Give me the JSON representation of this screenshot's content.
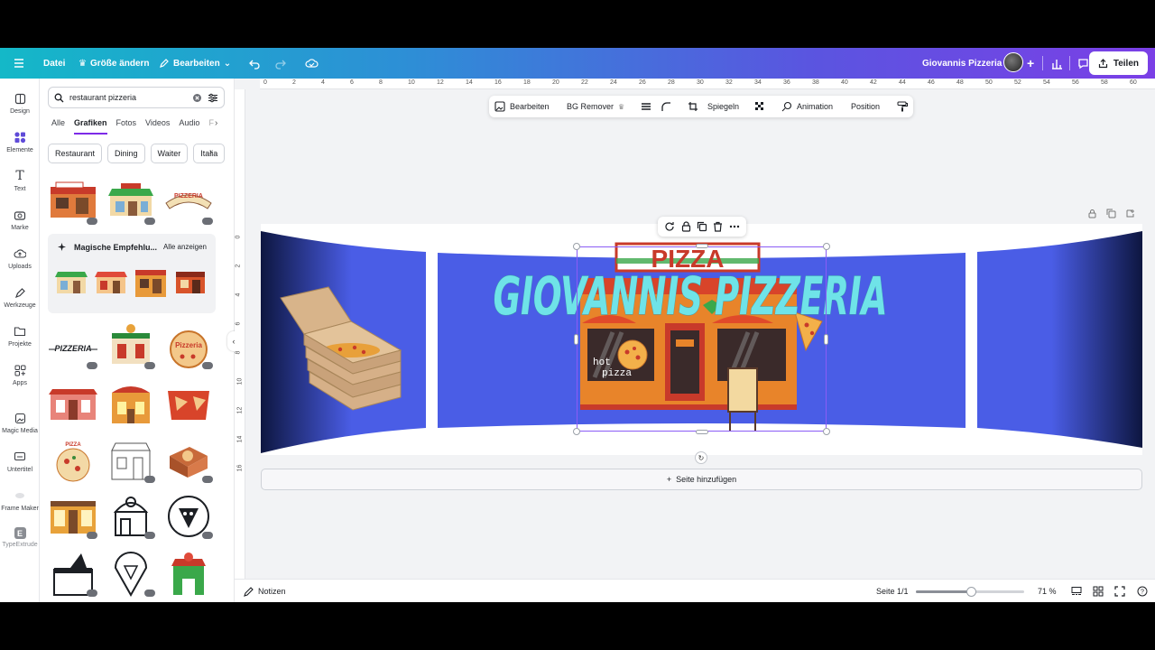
{
  "topbar": {
    "file": "Datei",
    "resize": "Größe ändern",
    "edit": "Bearbeiten",
    "project_title": "Giovannis Pizzeria",
    "share": "Teilen"
  },
  "rail": [
    {
      "label": "Design"
    },
    {
      "label": "Elemente"
    },
    {
      "label": "Text"
    },
    {
      "label": "Marke"
    },
    {
      "label": "Uploads"
    },
    {
      "label": "Werkzeuge"
    },
    {
      "label": "Projekte"
    },
    {
      "label": "Apps"
    },
    {
      "label": "Magic Media"
    },
    {
      "label": "Untertitel"
    },
    {
      "label": "Frame Maker"
    },
    {
      "label": "TypeExtrude"
    }
  ],
  "panel": {
    "search_value": "restaurant pizzeria",
    "tabs": [
      "Alle",
      "Grafiken",
      "Fotos",
      "Videos",
      "Audio",
      "F"
    ],
    "active_tab": "Grafiken",
    "chips": [
      "Restaurant",
      "Dining",
      "Waiter",
      "Italia"
    ],
    "magic_title": "Magische Empfehlu...",
    "magic_all": "Alle anzeigen"
  },
  "ruler": {
    "top": [
      "0",
      "2",
      "4",
      "6",
      "8",
      "10",
      "12",
      "14",
      "16",
      "18",
      "20",
      "22",
      "24",
      "26",
      "28",
      "30",
      "32",
      "34",
      "36",
      "38",
      "40",
      "42",
      "44",
      "46",
      "48",
      "50",
      "52",
      "54",
      "56",
      "58",
      "60"
    ],
    "left": [
      "0",
      "2",
      "4",
      "6",
      "8",
      "10",
      "12",
      "14",
      "16"
    ]
  },
  "context_toolbar": {
    "edit": "Bearbeiten",
    "bg_remover": "BG Remover",
    "flip": "Spiegeln",
    "animation": "Animation",
    "position": "Position"
  },
  "canvas": {
    "headline": "GIOVANNIS PIZZERIA",
    "sign_text": "PIZZA",
    "window_text_1": "hot",
    "window_text_2": "pizza",
    "add_page": "Seite hinzufügen"
  },
  "bottom": {
    "notes": "Notizen",
    "page_indicator": "Seite 1/1",
    "zoom": "71 %",
    "zoom_value": 71
  },
  "colors": {
    "accent": "#7d2ae8",
    "banner_blue": "#4a5de6",
    "headline": "#6fe3e8"
  }
}
